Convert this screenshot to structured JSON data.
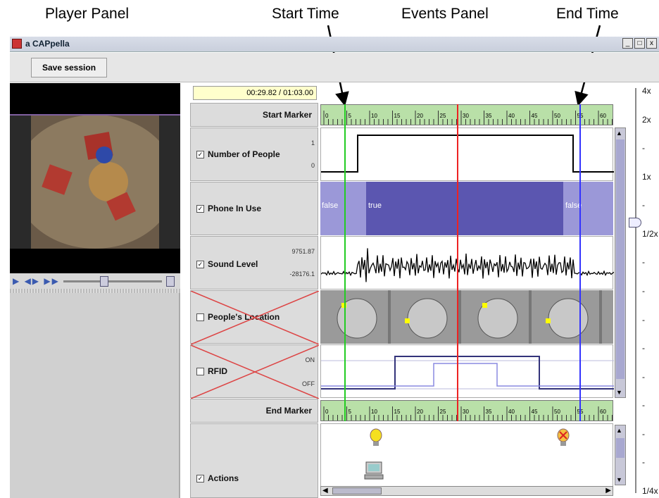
{
  "annotations": {
    "player_panel": "Player Panel",
    "start_time": "Start Time",
    "events_panel": "Events Panel",
    "end_time": "End Time"
  },
  "window": {
    "title": "a CAPpella",
    "min": "_",
    "max": "□",
    "close": "x"
  },
  "toolbar": {
    "save_label": "Save session"
  },
  "time_display": "00:29.82 / 01:03.00",
  "rows": {
    "start_marker": "Start Marker",
    "num_people": {
      "label": "Number of People",
      "max": "1",
      "min": "0",
      "checked": "✓"
    },
    "phone": {
      "label": "Phone In Use",
      "checked": "✓",
      "v1": "false",
      "v2": "true",
      "v3": "false"
    },
    "sound": {
      "label": "Sound Level",
      "max": "9751.87",
      "min": "-28176.1",
      "checked": "✓"
    },
    "location": {
      "label": "People's Location",
      "checked": ""
    },
    "rfid": {
      "label": "RFID",
      "on": "ON",
      "off": "OFF",
      "checked": ""
    },
    "end_marker": "End Marker",
    "actions": {
      "label": "Actions",
      "checked": "✓"
    }
  },
  "ruler_ticks": [
    "0",
    "5",
    "10",
    "15",
    "20",
    "25",
    "30",
    "35",
    "40",
    "45",
    "50",
    "55",
    "60"
  ],
  "speed_labels": [
    "4x",
    "2x",
    "-",
    "1x",
    "-",
    "1/2x",
    "-",
    "-",
    "-",
    "-",
    "-",
    "-",
    "-",
    "-",
    "1/4x"
  ],
  "playhead": {
    "current": 29.82,
    "total": 63.0,
    "start": 5,
    "end": 55
  }
}
